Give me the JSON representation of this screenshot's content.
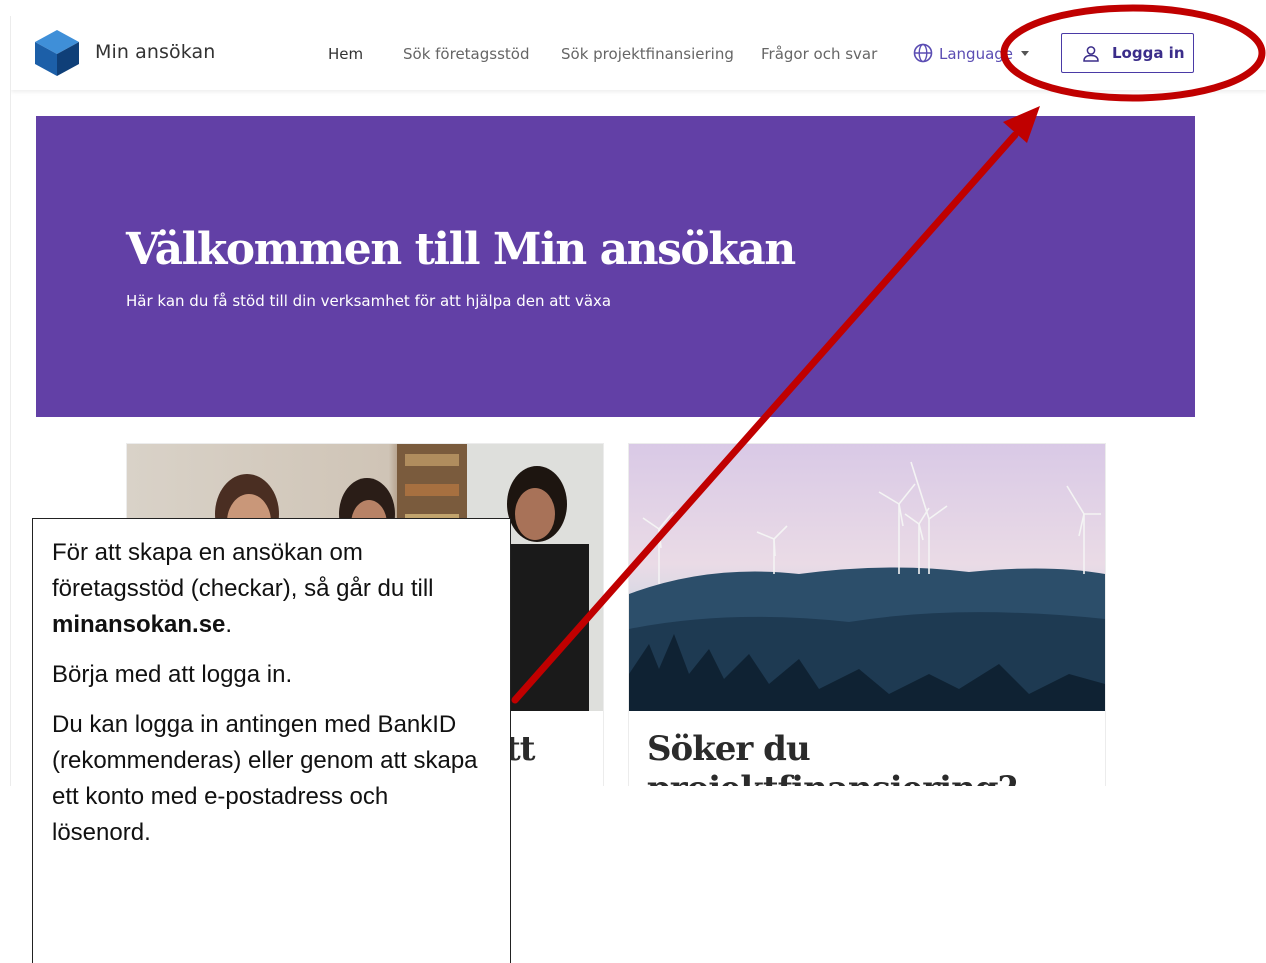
{
  "header": {
    "app_name": "Min ansökan",
    "nav": [
      {
        "label": "Hem"
      },
      {
        "label": "Sök företagsstöd"
      },
      {
        "label": "Sök projektfinansiering"
      },
      {
        "label": "Frågor och svar"
      }
    ],
    "language_label": "Language",
    "login_label": "Logga in"
  },
  "hero": {
    "title": "Välkommen till Min ansökan",
    "subtitle": "Här kan du få stöd till din verksamhet för att hjälpa den att växa"
  },
  "cards": [
    {
      "title_visible": "tt"
    },
    {
      "title_line1": "Söker du",
      "title_line2": "projektfinansiering?"
    }
  ],
  "callout": {
    "p1_text": "För att skapa en ansökan om företagsstöd (checkar), så går du till ",
    "p1_link": "minansokan.se",
    "p1_end": ".",
    "p2": "Börja med att logga in.",
    "p3": "Du kan logga in antingen med BankID (rekommenderas) eller genom att skapa ett konto med e-postadress och lösenord."
  },
  "colors": {
    "hero_bg": "#6240a6",
    "accent": "#4a3aa6",
    "annotation_red": "#c00000"
  }
}
